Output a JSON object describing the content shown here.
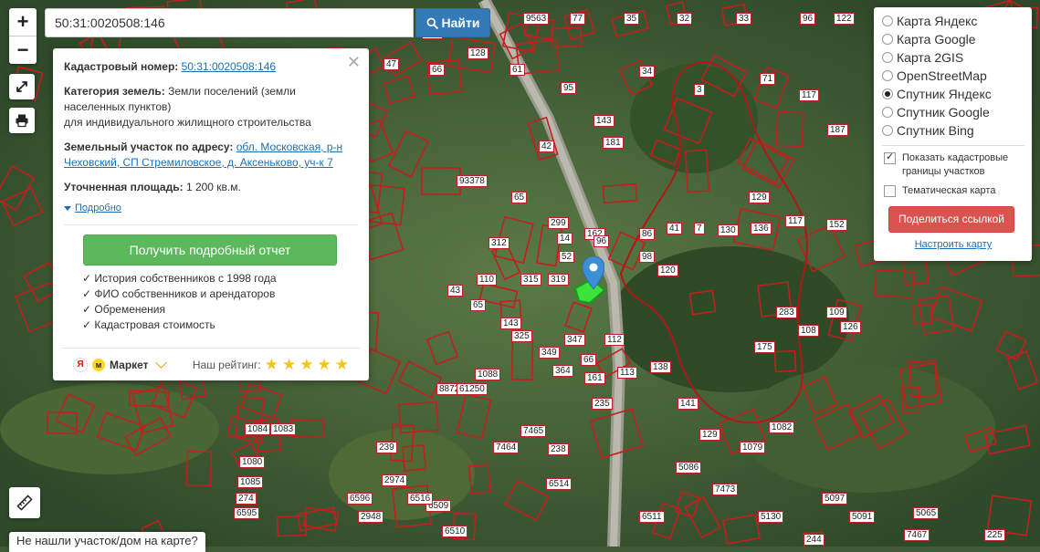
{
  "search": {
    "value": "50:31:0020508:146",
    "button_label": "Найти"
  },
  "map_controls": {
    "zoom_in": "+",
    "zoom_out": "−"
  },
  "colors": {
    "parcel_border": "#c41e1e",
    "report_button": "#5cb85c",
    "share_button": "#d9534f",
    "search_button": "#337ab7",
    "highlight_parcel": "#3be33b",
    "pin": "#3b8fd6"
  },
  "info": {
    "cadastral_label": "Кадастровый номер:",
    "cadastral_value": "50:31:0020508:146",
    "category_label": "Категория земель:",
    "category_value": "Земли поселений (земли населенных пунктов)",
    "category_extra": "для индивидуального жилищного строительства",
    "address_label": "Земельный участок по адресу:",
    "address_value": "обл. Московская, р-н Чеховский, СП Стремиловское, д. Аксеньково, уч-к 7",
    "area_label": "Уточненная площадь:",
    "area_value": "1 200 кв.м.",
    "more_label": "Подробно",
    "report_button": "Получить подробный отчет",
    "features": [
      "✓ История собственников с 1998 года",
      "✓ ФИО собственников и арендаторов",
      "✓ Обременения",
      "✓ Кадастровая стоимость"
    ],
    "market_label": "Маркет",
    "rating_label": "Наш рейтинг:",
    "rating": 5
  },
  "layers": {
    "options": [
      {
        "label": "Карта Яндекс",
        "selected": false
      },
      {
        "label": "Карта Google",
        "selected": false
      },
      {
        "label": "Карта 2GIS",
        "selected": false
      },
      {
        "label": "OpenStreetMap",
        "selected": false
      },
      {
        "label": "Спутник Яндекс",
        "selected": true
      },
      {
        "label": "Спутник Google",
        "selected": false
      },
      {
        "label": "Спутник Bing",
        "selected": false
      }
    ],
    "show_borders_label": "Показать кадастровые границы участков",
    "show_borders_checked": true,
    "thematic_label": "Тематическая карта",
    "thematic_checked": false,
    "share_button": "Поделиться ссылкой",
    "setup_link": "Настроить карту"
  },
  "bottom": {
    "not_found": "Не нашли участок/дом на карте?"
  },
  "parcel_labels": [
    "295",
    "48",
    "1010",
    "115",
    "31",
    "77",
    "35",
    "32",
    "33",
    "96",
    "122",
    "320",
    "49",
    "47",
    "66",
    "128",
    "61",
    "95",
    "34",
    "3",
    "71",
    "117",
    "187",
    "143",
    "181",
    "42",
    "93378",
    "65",
    "299",
    "162",
    "86",
    "41",
    "7",
    "130",
    "129",
    "136",
    "117",
    "152",
    "312",
    "315",
    "319",
    "14",
    "52",
    "96",
    "98",
    "120",
    "110",
    "43",
    "65",
    "143",
    "175",
    "283",
    "108",
    "109",
    "126",
    "325",
    "349",
    "364",
    "347",
    "66",
    "161",
    "112",
    "113",
    "138",
    "141",
    "129",
    "1079",
    "1082",
    "1088",
    "8872",
    "61250",
    "7465",
    "7464",
    "238",
    "235",
    "239",
    "1084",
    "1083",
    "1080",
    "1085",
    "274",
    "6595",
    "6596",
    "2948",
    "6509",
    "6510",
    "6511",
    "5097",
    "5091",
    "5086",
    "7473",
    "7467",
    "5065",
    "5130",
    "2974",
    "6516",
    "6514",
    "225",
    "244",
    "270",
    "274",
    "1105",
    "7463",
    "9563"
  ]
}
